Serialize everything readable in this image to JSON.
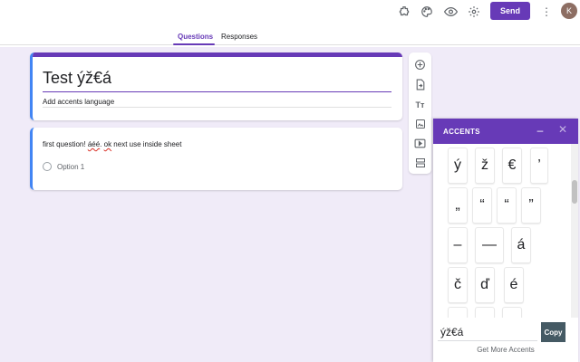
{
  "header": {
    "send_label": "Send",
    "avatar_initial": "K",
    "tabs": [
      {
        "label": "Questions",
        "active": true
      },
      {
        "label": "Responses",
        "active": false
      }
    ],
    "icons": [
      "addons-icon",
      "palette-icon",
      "preview-eye-icon",
      "settings-gear-icon",
      "more-vert-icon"
    ],
    "accent_color": "#673ab7"
  },
  "form": {
    "title": "Test ýž€á",
    "description": "Add accents language"
  },
  "question": {
    "text_parts": [
      "first question! ",
      "áéé",
      ". ",
      "ok",
      " next use inside sheet"
    ],
    "option": "Option 1"
  },
  "toolbar": {
    "icons": [
      "add-question-icon",
      "import-questions-icon",
      "add-title-icon",
      "add-image-icon",
      "add-video-icon",
      "add-section-icon"
    ],
    "title_glyph": "Tт"
  },
  "accents": {
    "title": "ACCENTS",
    "minimize": "–",
    "close": "✕",
    "rows": [
      [
        "ý",
        "ž",
        "€",
        "’"
      ],
      [
        "„",
        "“",
        "“",
        "”"
      ],
      [
        "–",
        "—",
        "á"
      ],
      [
        "č",
        "ď",
        "é"
      ],
      [
        "",
        "",
        ""
      ]
    ],
    "output_value": "ýž€á",
    "copy_label": "Copy",
    "more_label": "Get More Accents"
  }
}
